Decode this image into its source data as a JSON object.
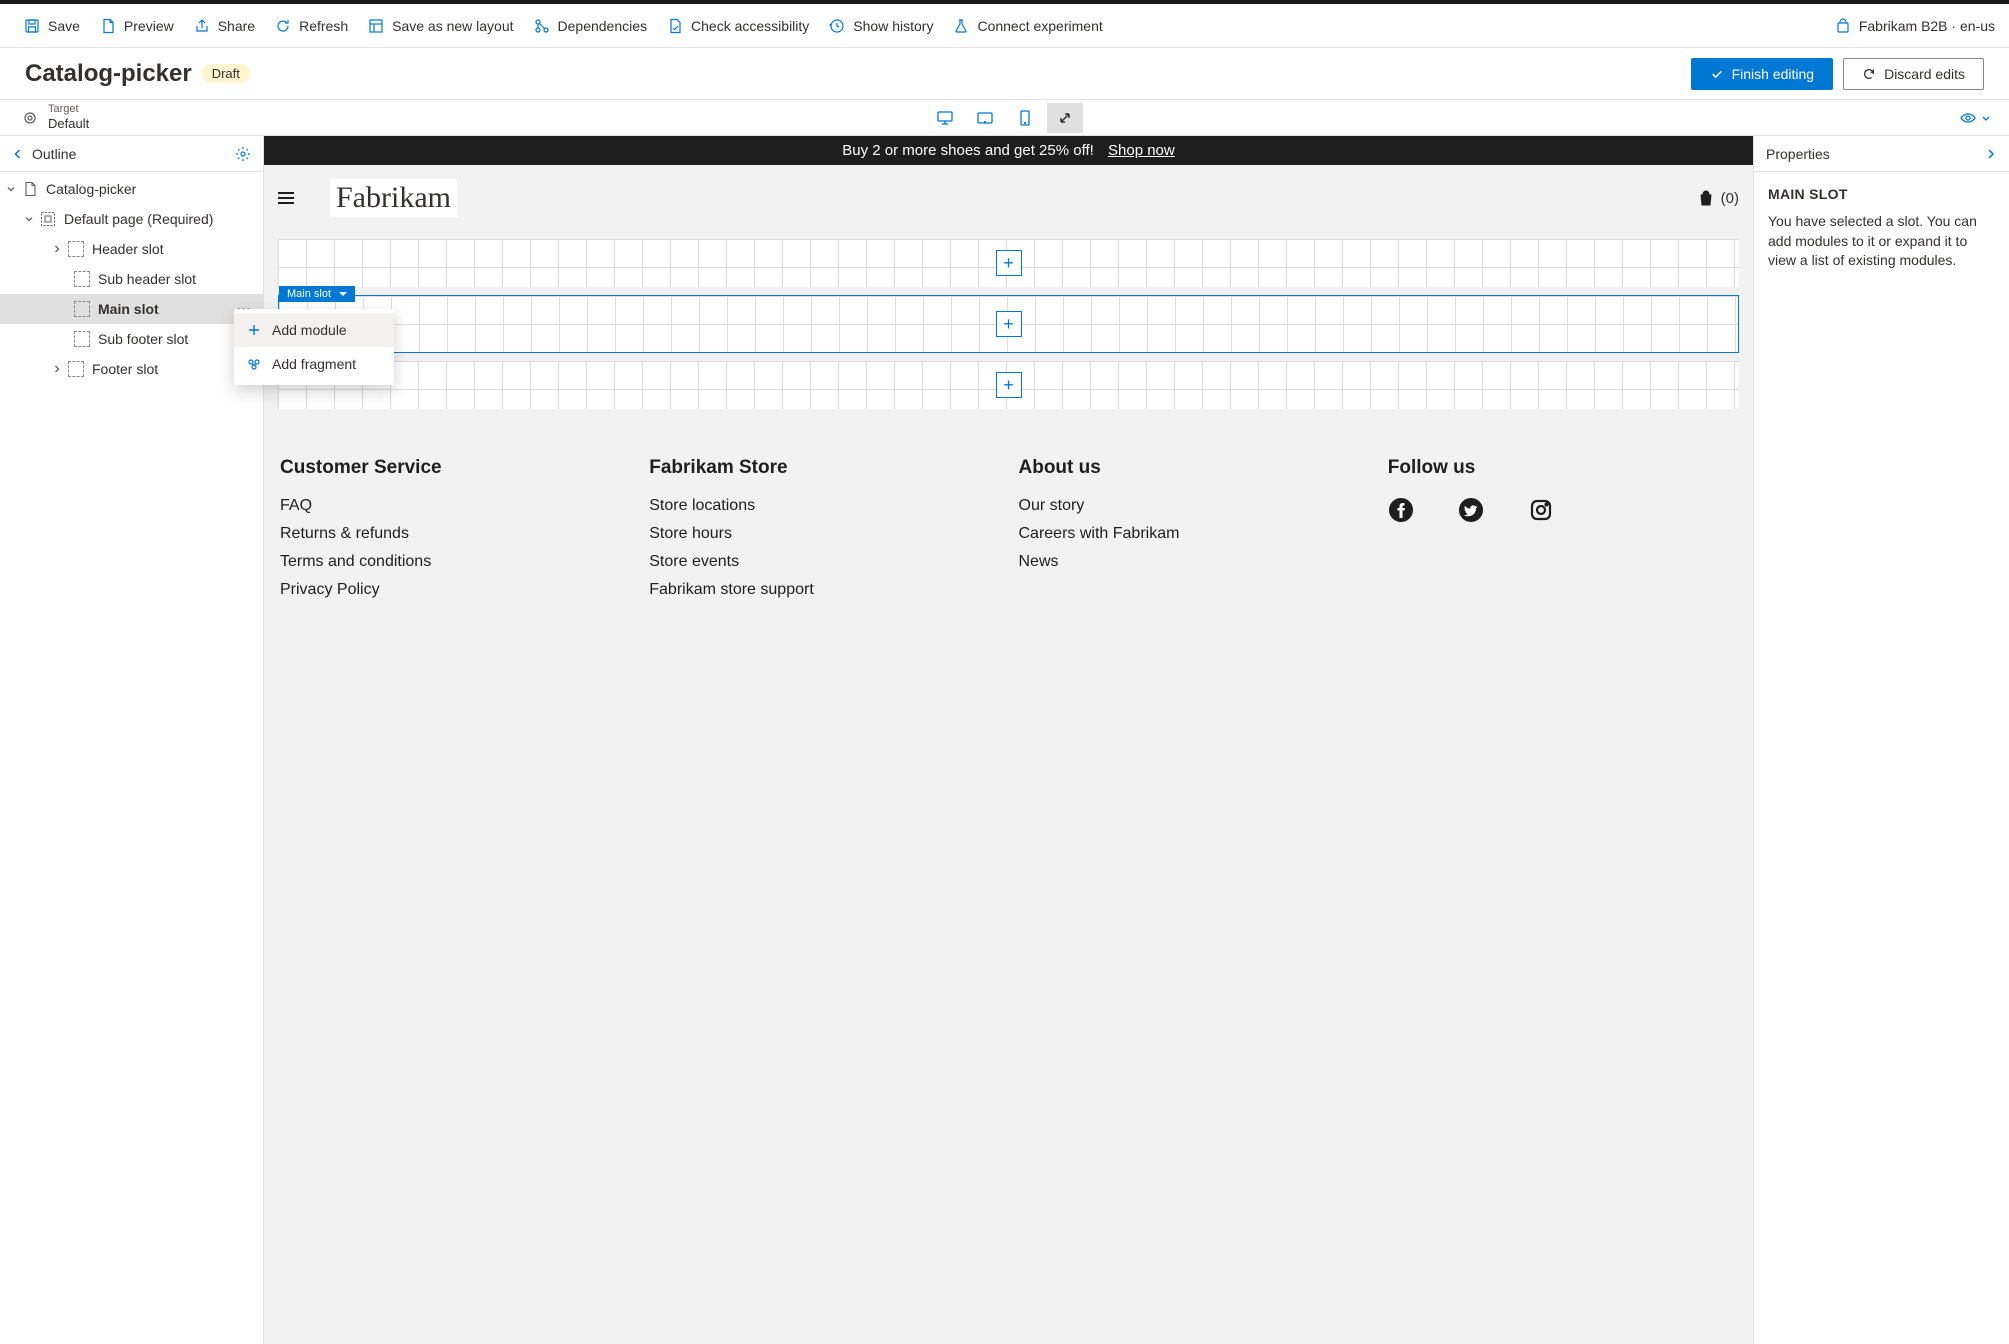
{
  "commandBar": {
    "save": "Save",
    "preview": "Preview",
    "share": "Share",
    "refresh": "Refresh",
    "saveAsLayout": "Save as new layout",
    "dependencies": "Dependencies",
    "checkA11y": "Check accessibility",
    "showHistory": "Show history",
    "connectExperiment": "Connect experiment",
    "storePill": "Fabrikam B2B · en-us"
  },
  "title": {
    "pageName": "Catalog-picker",
    "badge": "Draft",
    "finish": "Finish editing",
    "discard": "Discard edits"
  },
  "target": {
    "label": "Target",
    "value": "Default"
  },
  "outline": {
    "header": "Outline",
    "root": "Catalog-picker",
    "page": "Default page (Required)",
    "slots": {
      "header": "Header slot",
      "subHeader": "Sub header slot",
      "main": "Main slot",
      "subFooter": "Sub footer slot",
      "footer": "Footer slot"
    }
  },
  "contextMenu": {
    "addModule": "Add module",
    "addFragment": "Add fragment"
  },
  "preview": {
    "promoText": "Buy 2 or more shoes and get 25% off!",
    "promoLink": "Shop now",
    "brand": "Fabrikam",
    "cartCount": "(0)",
    "zoneLabel": "Main slot",
    "footer": {
      "col1": {
        "title": "Customer Service",
        "links": [
          "FAQ",
          "Returns & refunds",
          "Terms and conditions",
          "Privacy Policy"
        ]
      },
      "col2": {
        "title": "Fabrikam Store",
        "links": [
          "Store locations",
          "Store hours",
          "Store events",
          "Fabrikam store support"
        ]
      },
      "col3": {
        "title": "About us",
        "links": [
          "Our story",
          "Careers with Fabrikam",
          "News"
        ]
      },
      "col4": {
        "title": "Follow us"
      }
    }
  },
  "properties": {
    "header": "Properties",
    "slotTitle": "MAIN SLOT",
    "description": "You have selected a slot. You can add modules to it or expand it to view a list of existing modules."
  }
}
